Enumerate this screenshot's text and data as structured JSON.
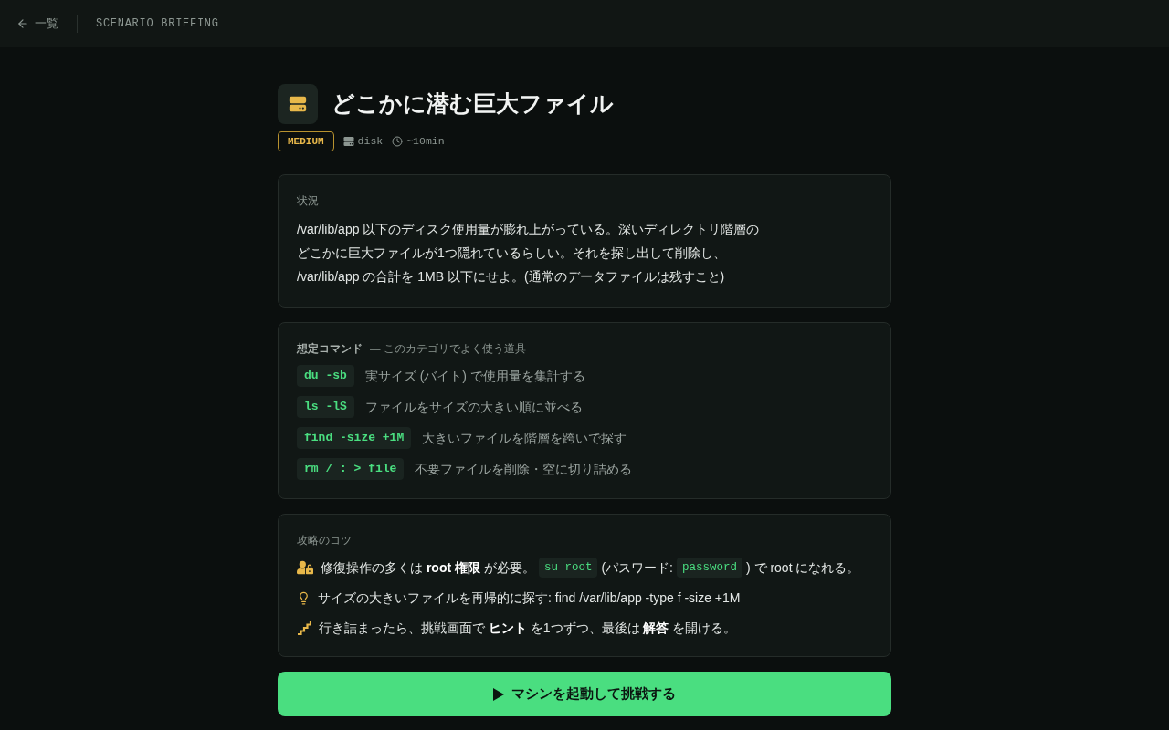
{
  "top_bar": {
    "back_link": {
      "label": "一覧"
    },
    "title": "SCENARIO BRIEFING"
  },
  "scenario": {
    "title": "どこかに潜む巨大ファイル",
    "difficulty": "MEDIUM",
    "category": "disk",
    "duration": "~10min"
  },
  "situation": {
    "heading": "状況",
    "body_lines": [
      "/var/lib/app 以下のディスク使用量が膨れ上がっている。深いディレクトリ階層の",
      "どこかに巨大ファイルが1つ隠れているらしい。それを探し出して削除し、",
      "/var/lib/app の合計を 1MB 以下にせよ。(通常のデータファイルは残すこと)"
    ]
  },
  "commands": {
    "heading": "想定コマンド",
    "subheading": "— このカテゴリでよく使う道具",
    "items": [
      {
        "command": "du -sb",
        "description": "実サイズ (バイト) で使用量を集計する"
      },
      {
        "command": "ls -lS",
        "description": "ファイルをサイズの大きい順に並べる"
      },
      {
        "command": "find -size +1M",
        "description": "大きいファイルを階層を跨いで探す"
      },
      {
        "command": "rm / : > file",
        "description": "不要ファイルを削除・空に切り詰める"
      }
    ]
  },
  "tips": {
    "heading": "攻略のコツ",
    "items": [
      {
        "parts": [
          {
            "kind": "text",
            "text": "修復操作の多くは **root 権限** が必要。"
          },
          {
            "kind": "code",
            "text": "su root"
          },
          {
            "kind": "text",
            "text": "(パスワード:"
          },
          {
            "kind": "code",
            "text": "password"
          },
          {
            "kind": "text",
            "text": ") で root になれる。"
          }
        ]
      },
      {
        "parts": [
          {
            "kind": "text",
            "text": "サイズの大きいファイルを再帰的に探す: find /var/lib/app -type f -size +1M"
          }
        ]
      },
      {
        "parts": [
          {
            "kind": "text",
            "text": "行き詰まったら、挑戦画面で **ヒント** を1つずつ、最後は **解答** を開ける。"
          }
        ]
      }
    ]
  },
  "start_button": {
    "label": "マシンを起動して挑戦する"
  }
}
